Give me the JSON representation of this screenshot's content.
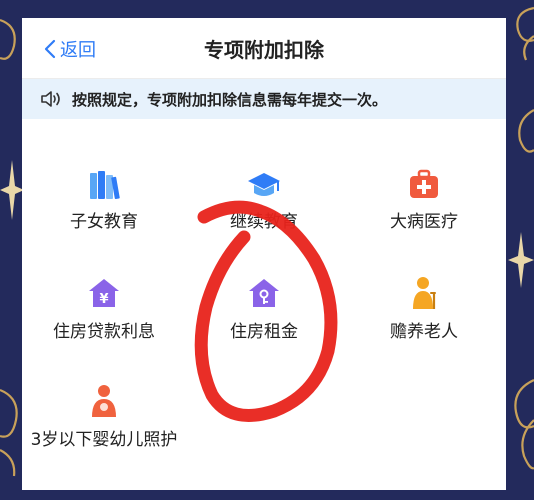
{
  "nav": {
    "back_label": "返回",
    "title": "专项附加扣除"
  },
  "notice": {
    "text": "按照规定，专项附加扣除信息需每年提交一次。"
  },
  "items": [
    {
      "label": "子女教育",
      "icon": "books-icon"
    },
    {
      "label": "继续教育",
      "icon": "graduation-cap-icon"
    },
    {
      "label": "大病医疗",
      "icon": "medical-kit-icon"
    },
    {
      "label": "住房贷款利息",
      "icon": "house-yuan-icon"
    },
    {
      "label": "住房租金",
      "icon": "house-key-icon"
    },
    {
      "label": "赡养老人",
      "icon": "elder-person-icon"
    },
    {
      "label": "3岁以下婴幼儿照护",
      "icon": "mother-baby-icon"
    }
  ],
  "colors": {
    "accent": "#2f7cf6",
    "notice_bg": "#e7f2fc",
    "page_bg": "#232a5c",
    "annotation_red": "#e8231b",
    "gold_decor": "#c8a15a"
  }
}
